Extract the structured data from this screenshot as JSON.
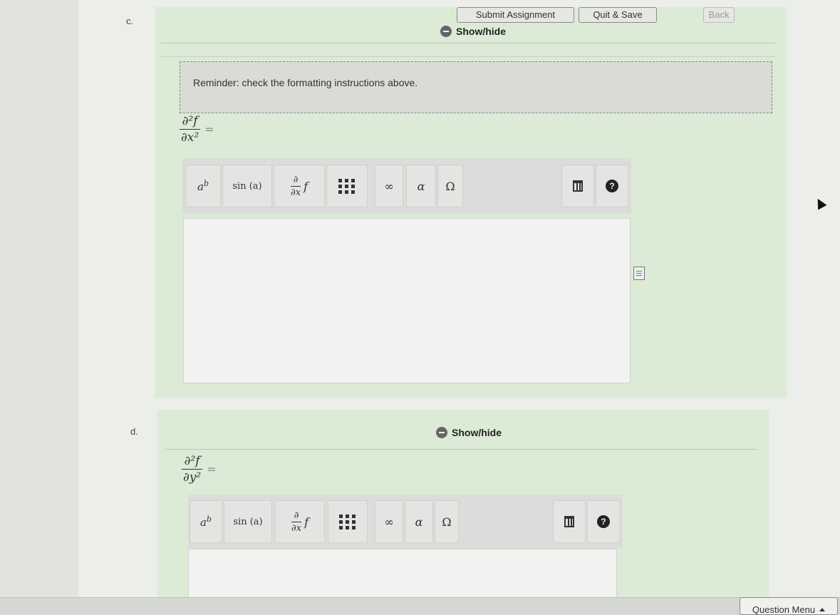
{
  "part_c": {
    "label": "c.",
    "show_hide": "Show/hide",
    "reminder": "Reminder: check the formatting instructions above.",
    "derivative": {
      "numerator": "∂²f",
      "denominator": "∂x²",
      "equals": "="
    }
  },
  "part_d": {
    "label": "d.",
    "show_hide": "Show/hide",
    "derivative": {
      "numerator": "∂²f",
      "denominator": "∂y²",
      "equals": "="
    }
  },
  "toolbar": {
    "power_base": "a",
    "power_exp": "b",
    "sin": "sin (a)",
    "deriv_num": "∂",
    "deriv_den": "∂x",
    "deriv_f": "f",
    "infinity": "∞",
    "alpha": "α",
    "omega": "Ω",
    "help": "?",
    "icons": [
      "power-icon",
      "sine-icon",
      "derivative-icon",
      "matrix-icon",
      "infinity-icon",
      "alpha-icon",
      "omega-icon",
      "trash-icon",
      "help-icon"
    ]
  },
  "footer": {
    "submit": "Submit Assignment",
    "quit": "Quit & Save",
    "back": "Back",
    "question_menu": "Question Menu"
  }
}
